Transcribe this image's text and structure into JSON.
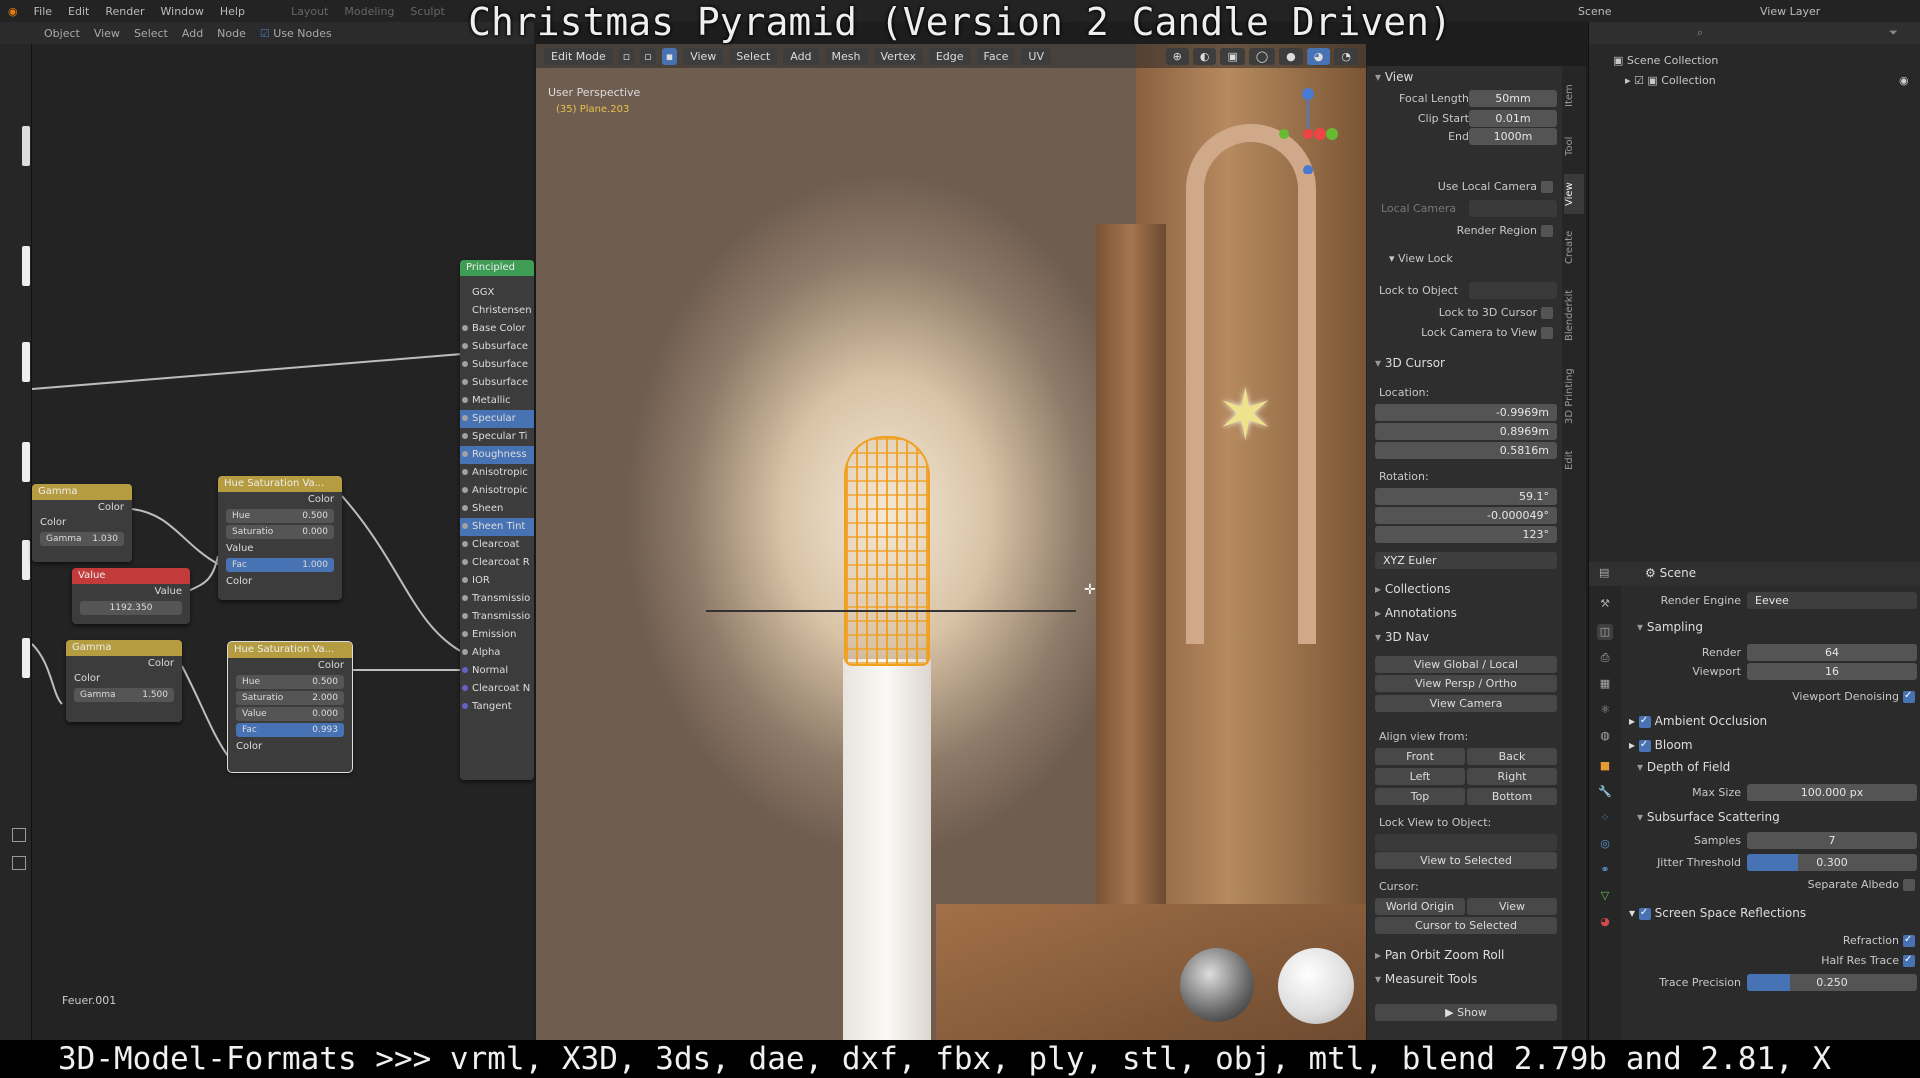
{
  "overlay": {
    "title": "Christmas Pyramid (Version 2 Candle Driven)",
    "bottom": "3D-Model-Formats >>> vrml, X3D, 3ds, dae, dxf, fbx, ply, stl, obj, mtl, blend 2.79b and 2.81, X"
  },
  "topbar": {
    "menus": [
      "File",
      "Edit",
      "Render",
      "Window",
      "Help"
    ],
    "workspaces": [
      "Layout",
      "Modeling",
      "Sculpt"
    ],
    "scene": "Scene",
    "view_layer": "View Layer"
  },
  "node_editor": {
    "header": [
      "Object",
      "View",
      "Select",
      "Add",
      "Node",
      "Use Nodes"
    ],
    "frame_label": "Feuer.001",
    "gamma1": {
      "title": "Gamma",
      "out": "Color",
      "in": "Color",
      "gamma_label": "Gamma",
      "gamma": "1.030"
    },
    "value": {
      "title": "Value",
      "out": "Value",
      "val": "1192.350"
    },
    "gamma2": {
      "title": "Gamma",
      "out": "Color",
      "in": "Color",
      "gamma_label": "Gamma",
      "gamma": "1.500"
    },
    "hsv1": {
      "title": "Hue Saturation Va...",
      "out": "Color",
      "hue_label": "Hue",
      "hue": "0.500",
      "sat_label": "Saturatio",
      "sat": "0.000",
      "val_label": "Value",
      "fac_label": "Fac",
      "fac": "1.000",
      "color_label": "Color"
    },
    "hsv2": {
      "title": "Hue Saturation Va...",
      "out": "Color",
      "hue_label": "Hue",
      "hue": "0.500",
      "sat_label": "Saturatio",
      "sat": "2.000",
      "val_label": "Value",
      "val": "0.000",
      "fac_label": "Fac",
      "fac": "0.993",
      "color_label": "Color"
    },
    "principled": {
      "title": "Principled",
      "rows": [
        "GGX",
        "Christensen",
        "Base Color",
        "Subsurface",
        "Subsurface",
        "Subsurface",
        "Metallic",
        "Specular",
        "Specular Ti",
        "Roughness",
        "Anisotropic",
        "Anisotropic",
        "Sheen",
        "Sheen Tint",
        "Clearcoat",
        "Clearcoat R",
        "IOR",
        "Transmissio",
        "Transmissio",
        "Emission",
        "Alpha",
        "Normal",
        "Clearcoat N",
        "Tangent"
      ],
      "selected": [
        7,
        9,
        13
      ]
    }
  },
  "viewport": {
    "header": [
      "Edit Mode",
      "View",
      "Select",
      "Add",
      "Mesh",
      "Vertex",
      "Edge",
      "Face",
      "UV"
    ],
    "perspective": "User Perspective",
    "object": "(35) Plane.203"
  },
  "npanel": {
    "view": {
      "section": "View",
      "focal_label": "Focal Length",
      "focal": "50mm",
      "clip_start_label": "Clip Start",
      "clip_start": "0.01m",
      "end_label": "End",
      "end": "1000m",
      "use_local_camera": "Use Local Camera",
      "local_camera": "Local Camera",
      "render_region": "Render Region",
      "view_lock": "View Lock",
      "lock_to_object": "Lock to Object",
      "lock_3d_cursor": "Lock to 3D Cursor",
      "lock_camera": "Lock Camera to View"
    },
    "cursor": {
      "section": "3D Cursor",
      "location_label": "Location:",
      "x": "-0.9969m",
      "y": "0.8969m",
      "z": "0.5816m",
      "rotation_label": "Rotation:",
      "rx": "59.1°",
      "ry": "-0.000049°",
      "rz": "123°",
      "mode": "XYZ Euler"
    },
    "collections": "Collections",
    "annotations": "Annotations",
    "nav": {
      "section": "3D Nav",
      "global_local": "View Global / Local",
      "persp_ortho": "View Persp / Ortho",
      "camera": "View Camera",
      "align_label": "Align view from:",
      "front": "Front",
      "back": "Back",
      "left": "Left",
      "right": "Right",
      "top": "Top",
      "bottom": "Bottom",
      "lock_view": "Lock View to Object:",
      "view_selected": "View to Selected",
      "cursor_label": "Cursor:",
      "world_origin": "World Origin",
      "view": "View",
      "cursor_to_selected": "Cursor to Selected"
    },
    "pan_orbit": "Pan Orbit Zoom Roll",
    "measure": "Measureit Tools",
    "show": "Show",
    "tabs": [
      "Item",
      "Tool",
      "View",
      "Create",
      "Blenderkit",
      "3D Printing",
      "Edit"
    ]
  },
  "outliner": {
    "title": "Scene Collection",
    "collection": "Collection"
  },
  "properties": {
    "scene": "Scene",
    "render_engine_label": "Render Engine",
    "render_engine": "Eevee",
    "sampling": "Sampling",
    "render_label": "Render",
    "render": "64",
    "viewport_label": "Viewport",
    "viewport": "16",
    "viewport_denoising": "Viewport Denoising",
    "ambient_occlusion": "Ambient Occlusion",
    "bloom": "Bloom",
    "dof": "Depth of Field",
    "max_size_label": "Max Size",
    "max_size": "100.000 px",
    "sss": "Subsurface Scattering",
    "samples_label": "Samples",
    "samples": "7",
    "jitter_label": "Jitter Threshold",
    "jitter": "0.300",
    "jitter_fill": 0.3,
    "separate_albedo": "Separate Albedo",
    "ssr": "Screen Space Reflections",
    "refraction": "Refraction",
    "half_res": "Half Res Trace",
    "trace_label": "Trace Precision",
    "trace": "0.250",
    "trace_fill": 0.25
  }
}
